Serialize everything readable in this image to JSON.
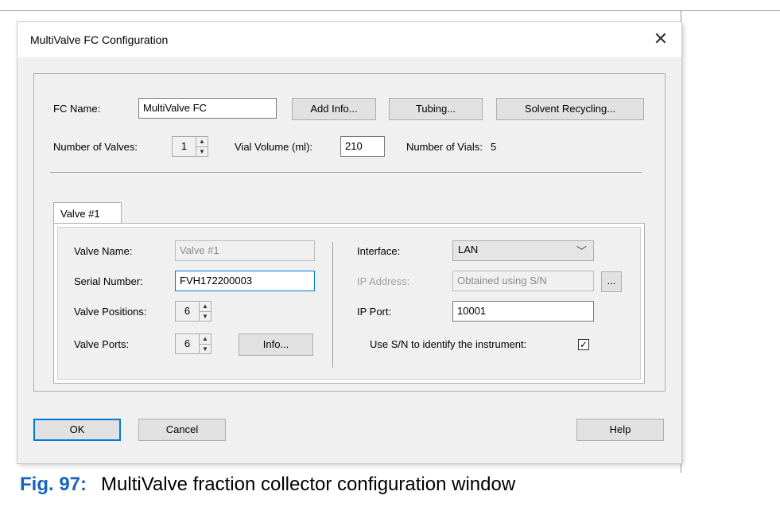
{
  "dialog": {
    "title": "MultiValve FC Configuration",
    "close_glyph": "✕"
  },
  "fc": {
    "name_label": "FC Name:",
    "name_value": "MultiValve FC",
    "add_info_button": "Add  Info...",
    "tubing_button": "Tubing...",
    "solvent_recycling_button": "Solvent Recycling...",
    "num_valves_label": "Number of Valves:",
    "num_valves_value": "1",
    "vial_volume_label": "Vial Volume (ml):",
    "vial_volume_value": "210",
    "num_vials_label": "Number of Vials:",
    "num_vials_value": "5"
  },
  "tabs": [
    {
      "label": "Valve #1"
    }
  ],
  "valve": {
    "name_label": "Valve Name:",
    "name_value": "Valve #1",
    "serial_label": "Serial Number:",
    "serial_value": "FVH172200003",
    "positions_label": "Valve Positions:",
    "positions_value": "6",
    "ports_label": "Valve Ports:",
    "ports_value": "6",
    "info_button": "Info...",
    "interface_label": "Interface:",
    "interface_value": "LAN",
    "ip_address_label": "IP Address:",
    "ip_address_value": "Obtained using S/N",
    "ip_browse_button": "...",
    "ip_port_label": "IP Port:",
    "ip_port_value": "10001",
    "use_sn_label": "Use S/N to identify the instrument:",
    "use_sn_checked": true,
    "check_glyph": "✓"
  },
  "footer": {
    "ok_button": "OK",
    "cancel_button": "Cancel",
    "help_button": "Help"
  },
  "caption": {
    "fig_label": "Fig. 97:",
    "text": "MultiValve fraction collector configuration window"
  },
  "colors": {
    "accent": "#0078d7",
    "caption_blue": "#1a63b8",
    "dialog_bg": "#f0f0f0"
  }
}
